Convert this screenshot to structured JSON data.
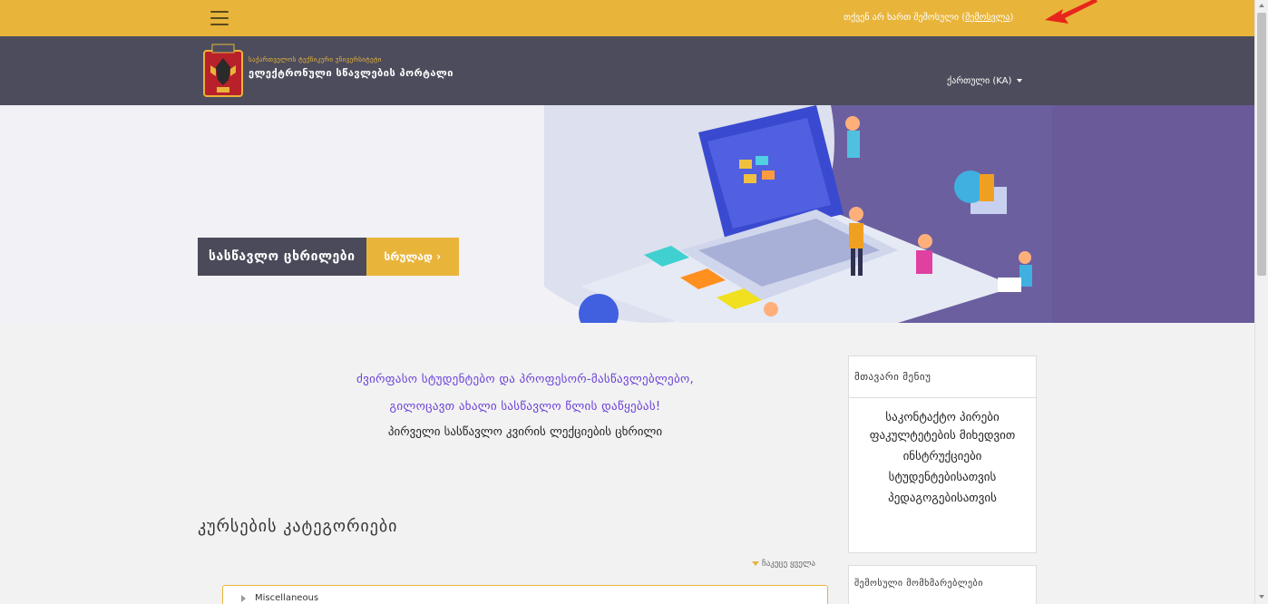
{
  "topbar": {
    "not_logged_text": "თქვენ არ ხართ შემოსული (",
    "login_link": "შემოსვლა",
    "close_paren": ")"
  },
  "header": {
    "university_small": "საქართველოს ტექნიკური უნივერსიტეტი",
    "portal_title": "ელექტრონული სწავლების პორტალი",
    "language": "ქართული (KA)"
  },
  "hero": {
    "schedule_label": "სასწავლო ცხრილები",
    "full_button": "სრულად ›"
  },
  "welcome": {
    "line1": "ძვირფასო სტუდენტებო და პროფესორ-მასწავლებლებო,",
    "line2": "გილოცავთ ახალი სასწავლო წლის დაწყებას!",
    "line3": "პირველი სასწავლო კვირის ლექციების ცხრილი"
  },
  "categories": {
    "title": "კურსების კატეგორიები",
    "collapse_all": "ჩაკეცე ყველა",
    "items": [
      {
        "name": "Miscellaneous"
      }
    ]
  },
  "main_menu": {
    "title": "მთავარი მენიუ",
    "items": [
      "საკონტაქტო პირები ფაკულტეტების მიხედვით",
      "ინსტრუქციები",
      "სტუდენტებისათვის",
      "პედაგოგებისათვის"
    ]
  },
  "online_users": {
    "title": "შემოსული მომხმარებლები"
  },
  "colors": {
    "gold": "#e8b43a",
    "dark_header": "#4c4c5c",
    "purple_text": "#6a3fd8"
  }
}
